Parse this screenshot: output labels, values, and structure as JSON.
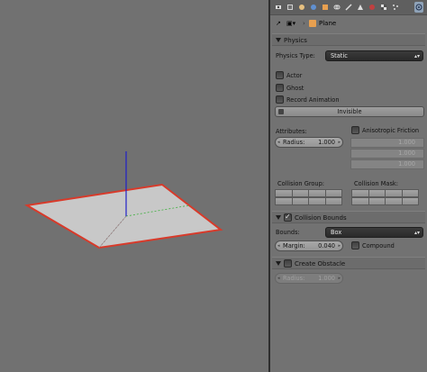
{
  "viewport": {
    "grid_colors": {
      "outline": "#d83a2a",
      "surface": "#c8c8c8",
      "axis_z": "#2020c8",
      "axis_y": "#40b040",
      "axis_x": "#c04040"
    }
  },
  "properties": {
    "header": {
      "tab_icons": [
        "render-icon",
        "render-layers-icon",
        "scene-icon",
        "world-icon",
        "object-icon",
        "constraints-icon",
        "modifiers-icon",
        "data-icon",
        "material-icon",
        "texture-icon",
        "particles-icon",
        "physics-icon"
      ],
      "context_object": "Plane"
    },
    "physics": {
      "title": "Physics",
      "physics_type_label": "Physics Type:",
      "physics_type_value": "Static",
      "actor_label": "Actor",
      "ghost_label": "Ghost",
      "record_animation_label": "Record Animation",
      "invisible_label": "Invisible",
      "attributes_label": "Attributes:",
      "radius_label": "Radius:",
      "radius_value": "1.000",
      "anisotropic_label": "Anisotropic Friction",
      "aniso_values": [
        "1.000",
        "1.000",
        "1.000"
      ],
      "collision_group_label": "Collision Group:",
      "collision_mask_label": "Collision Mask:"
    },
    "collision_bounds": {
      "title": "Collision Bounds",
      "enabled": true,
      "bounds_label": "Bounds:",
      "bounds_value": "Box",
      "margin_label": "Margin:",
      "margin_value": "0.040",
      "compound_label": "Compound"
    },
    "create_obstacle": {
      "title": "Create Obstacle",
      "enabled": false,
      "radius_label": "Radius:",
      "radius_value": "1.000"
    }
  }
}
